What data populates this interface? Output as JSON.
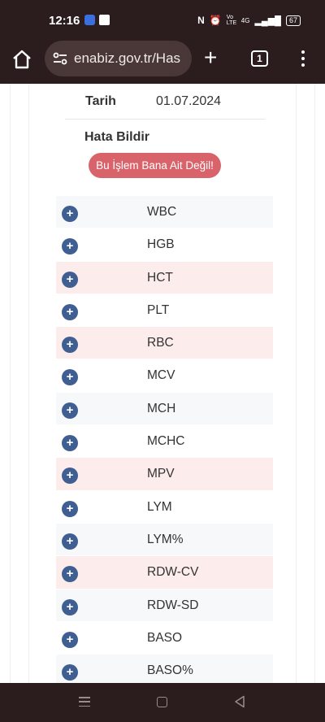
{
  "status": {
    "time": "12:16",
    "network": "Vo LTE",
    "signal": "4G",
    "battery": "67"
  },
  "browser": {
    "url": "enabiz.gov.tr/Has",
    "tab_count": "1"
  },
  "record": {
    "date_label": "Tarih",
    "date_value": "01.07.2024",
    "report_title": "Hata Bildir",
    "report_button": "Bu İşlem Bana Ait Değil!"
  },
  "tests": [
    {
      "name": "WBC",
      "tint": "grey"
    },
    {
      "name": "HGB",
      "tint": "plain"
    },
    {
      "name": "HCT",
      "tint": "pink"
    },
    {
      "name": "PLT",
      "tint": "plain"
    },
    {
      "name": "RBC",
      "tint": "pink"
    },
    {
      "name": "MCV",
      "tint": "plain"
    },
    {
      "name": "MCH",
      "tint": "grey"
    },
    {
      "name": "MCHC",
      "tint": "plain"
    },
    {
      "name": "MPV",
      "tint": "pink"
    },
    {
      "name": "LYM",
      "tint": "plain"
    },
    {
      "name": "LYM%",
      "tint": "grey"
    },
    {
      "name": "RDW-CV",
      "tint": "pink"
    },
    {
      "name": "RDW-SD",
      "tint": "grey"
    },
    {
      "name": "BASO",
      "tint": "plain"
    },
    {
      "name": "BASO%",
      "tint": "grey"
    }
  ],
  "expand_symbol": "+",
  "colors": {
    "chrome_bg": "#2b1d1d",
    "expand_button": "#3f5e91",
    "report_button": "#d9636a",
    "row_pink": "#fdecec",
    "row_grey": "#f7f8f9"
  }
}
